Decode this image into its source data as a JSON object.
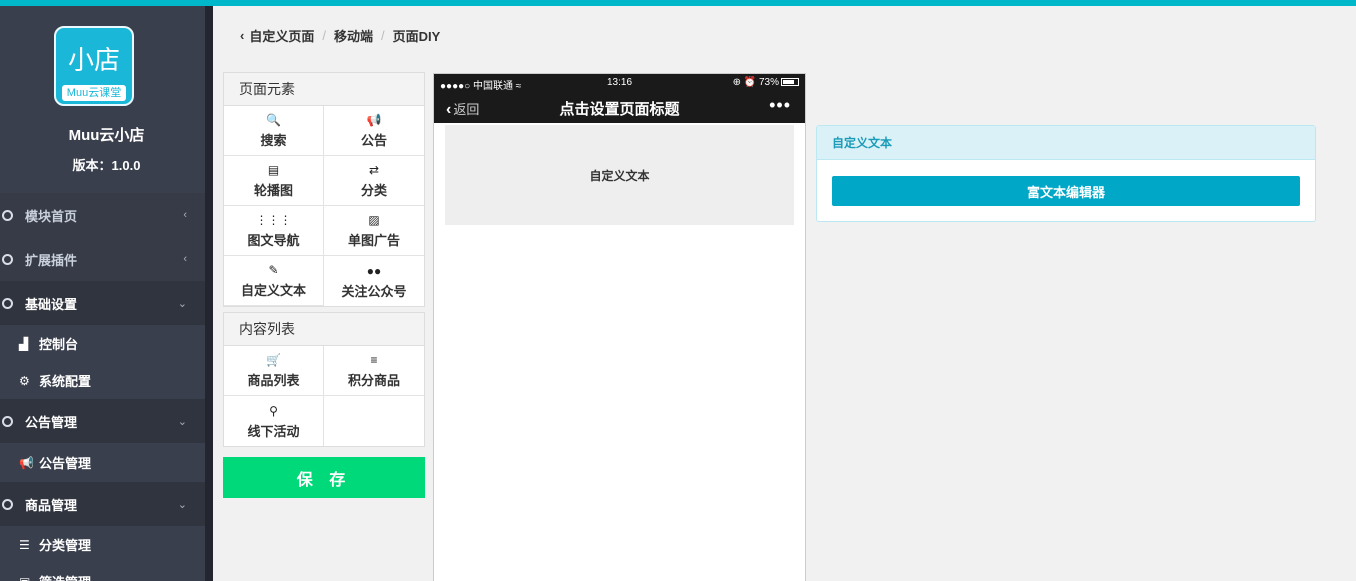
{
  "sidebar": {
    "logo_main": "小店",
    "logo_sub": "Muu云课堂",
    "site_name": "Muu云小店",
    "version": "版本：1.0.0",
    "groups": [
      {
        "label": "模块首页",
        "chevron": "‹"
      },
      {
        "label": "扩展插件",
        "chevron": "‹"
      },
      {
        "label": "基础设置",
        "chevron": "⌄"
      },
      {
        "label": "公告管理",
        "chevron": "⌄"
      },
      {
        "label": "商品管理",
        "chevron": "⌄"
      }
    ],
    "subitems": [
      {
        "label": "控制台",
        "icon": "area-chart-icon",
        "glyph": "▟"
      },
      {
        "label": "系统配置",
        "icon": "gears-icon",
        "glyph": "⚙"
      },
      {
        "label": "公告管理",
        "icon": "bullhorn-icon",
        "glyph": "📢"
      },
      {
        "label": "分类管理",
        "icon": "list-icon",
        "glyph": "☰"
      },
      {
        "label": "筛选管理",
        "icon": "filter-icon",
        "glyph": "▣"
      }
    ]
  },
  "breadcrumb": {
    "back_glyph": "‹",
    "items": [
      "自定义页面",
      "移动端",
      "页面DIY"
    ],
    "separator": "/"
  },
  "elements_panel": {
    "title": "页面元素",
    "items": [
      {
        "label": "搜索",
        "glyph": "🔍",
        "icon": "search-icon"
      },
      {
        "label": "公告",
        "glyph": "📢",
        "icon": "bullhorn-icon"
      },
      {
        "label": "轮播图",
        "glyph": "▤",
        "icon": "file-image-icon"
      },
      {
        "label": "分类",
        "glyph": "⇄",
        "icon": "exchange-icon"
      },
      {
        "label": "图文导航",
        "glyph": "⋮⋮⋮",
        "icon": "th-icon"
      },
      {
        "label": "单图广告",
        "glyph": "▨",
        "icon": "picture-icon"
      },
      {
        "label": "自定义文本",
        "glyph": "✎",
        "icon": "edit-icon"
      },
      {
        "label": "关注公众号",
        "glyph": "●●",
        "icon": "wechat-icon"
      }
    ]
  },
  "content_panel": {
    "title": "内容列表",
    "items": [
      {
        "label": "商品列表",
        "glyph": "🛒",
        "icon": "cart-icon"
      },
      {
        "label": "积分商品",
        "glyph": "≡",
        "icon": "database-icon"
      },
      {
        "label": "线下活动",
        "glyph": "⚲",
        "icon": "map-marker-icon"
      },
      {
        "label": "",
        "glyph": "",
        "icon": ""
      }
    ]
  },
  "save_button": "保 存",
  "phone": {
    "status_left": "●●●●○ 中国联通 ≈",
    "status_time": "13:16",
    "status_right": "⊕ ⏰ 73%",
    "back_label": "返回",
    "back_glyph": "‹",
    "title": "点击设置页面标题",
    "more": "•••",
    "text_block": "自定义文本"
  },
  "editor": {
    "title": "自定义文本",
    "button": "富文本编辑器"
  },
  "colors": {
    "accent": "#00b8c9",
    "sidebar": "#3a3f4d",
    "save": "#00d97a",
    "editor_button": "#00a7c6"
  }
}
